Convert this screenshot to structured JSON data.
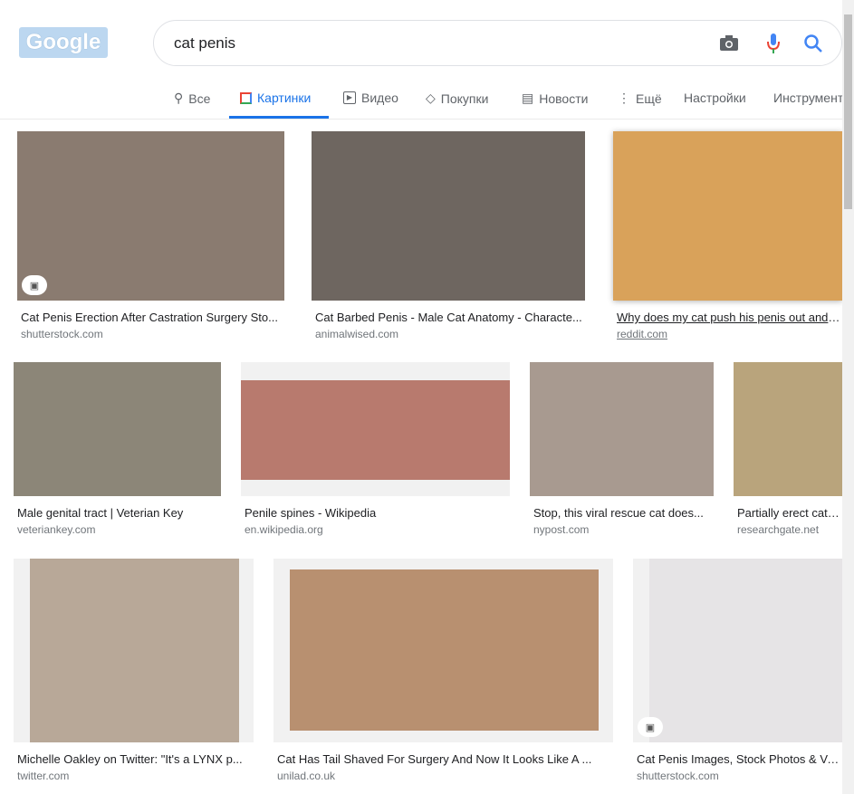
{
  "logo_text": "Google",
  "search": {
    "query": "cat penis"
  },
  "tabs": [
    {
      "label": "Все",
      "icon": "search-icon"
    },
    {
      "label": "Картинки",
      "icon": "image-icon",
      "active": true
    },
    {
      "label": "Видео",
      "icon": "play-icon"
    },
    {
      "label": "Покупки",
      "icon": "tag-icon"
    },
    {
      "label": "Новости",
      "icon": "news-icon"
    },
    {
      "label": "Ещё",
      "icon": "more-icon"
    },
    {
      "label": "Настройки"
    },
    {
      "label": "Инструменты"
    }
  ],
  "results": [
    {
      "title": "Cat Penis Erection After Castration Surgery Sto...",
      "source": "shutterstock.com",
      "color": "#8a7b70"
    },
    {
      "title": "Cat Barbed Penis - Male Cat Anatomy - Characte...",
      "source": "animalwised.com",
      "color": "#6e6660"
    },
    {
      "title": "Why does my cat push his penis out and lick it?",
      "source": "reddit.com",
      "color": "#d9a25a"
    },
    {
      "title": "Male genital tract | Veterian Key",
      "source": "veteriankey.com",
      "color": "#8c8678"
    },
    {
      "title": "Penile spines - Wikipedia",
      "source": "en.wikipedia.org",
      "color": "#b87a6e"
    },
    {
      "title": "Stop, this viral rescue cat does...",
      "source": "nypost.com",
      "color": "#a89a90"
    },
    {
      "title": "Partially erect cat penis",
      "source": "researchgate.net",
      "color": "#b9a47c"
    },
    {
      "title": "Michelle Oakley on Twitter: \"It's a LYNX p...",
      "source": "twitter.com",
      "color": "#b8a898"
    },
    {
      "title": "Cat Has Tail Shaved For Surgery And Now It Looks Like A ...",
      "source": "unilad.co.uk",
      "color": "#b89070"
    },
    {
      "title": "Cat Penis Images, Stock Photos & Vectors",
      "source": "shutterstock.com",
      "color": "#e6e4e6"
    }
  ]
}
